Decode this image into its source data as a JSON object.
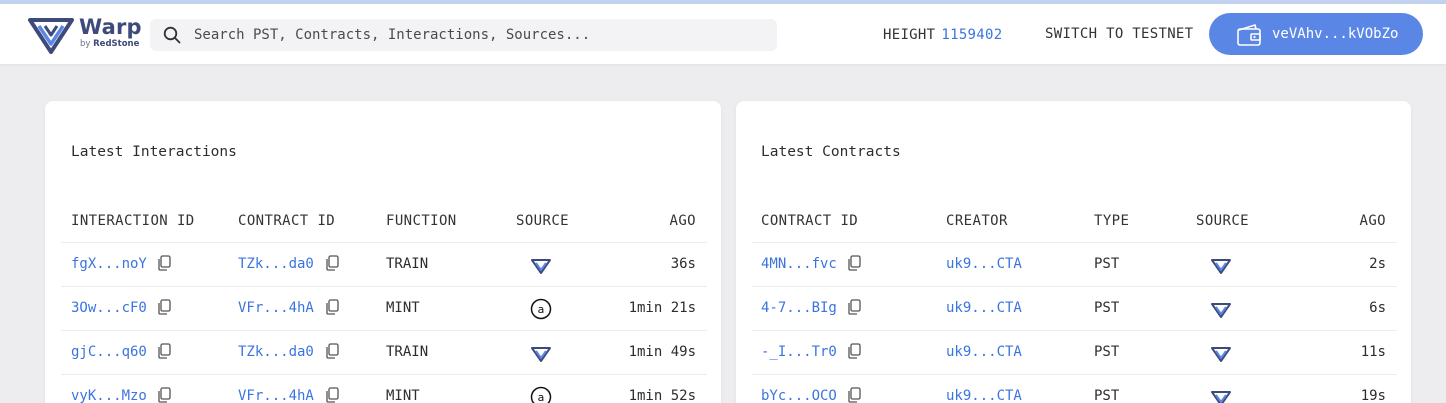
{
  "brand": {
    "name": "Warp",
    "by": "by",
    "by_name": "RedStone"
  },
  "search": {
    "placeholder": "Search PST, Contracts, Interactions, Sources..."
  },
  "network": {
    "height_label": "HEIGHT",
    "height_value": "1159402",
    "switch_label": "SWITCH TO TESTNET"
  },
  "wallet": {
    "address": "veVAhv...kVObZo"
  },
  "colors": {
    "accent": "#3a74e0",
    "wallet_button": "#5a87e6"
  },
  "interactions": {
    "title": "Latest Interactions",
    "headers": [
      "INTERACTION ID",
      "CONTRACT ID",
      "FUNCTION",
      "SOURCE",
      "AGO"
    ],
    "rows": [
      {
        "id": "fgX...noY",
        "contract": "TZk...da0",
        "function": "TRAIN",
        "source": "warp-icon",
        "ago": "36s"
      },
      {
        "id": "3Ow...cF0",
        "contract": "VFr...4hA",
        "function": "MINT",
        "source": "arweave-icon",
        "ago": "1min 21s"
      },
      {
        "id": "gjC...q60",
        "contract": "TZk...da0",
        "function": "TRAIN",
        "source": "warp-icon",
        "ago": "1min 49s"
      },
      {
        "id": "vyK...Mzo",
        "contract": "VFr...4hA",
        "function": "MINT",
        "source": "arweave-icon",
        "ago": "1min 52s"
      }
    ]
  },
  "contracts": {
    "title": "Latest Contracts",
    "headers": [
      "CONTRACT ID",
      "CREATOR",
      "TYPE",
      "SOURCE",
      "AGO"
    ],
    "rows": [
      {
        "id": "4MN...fvc",
        "creator": "uk9...CTA",
        "type": "PST",
        "source": "warp-icon",
        "ago": "2s"
      },
      {
        "id": "4-7...BIg",
        "creator": "uk9...CTA",
        "type": "PST",
        "source": "warp-icon",
        "ago": "6s"
      },
      {
        "id": "-_I...Tr0",
        "creator": "uk9...CTA",
        "type": "PST",
        "source": "warp-icon",
        "ago": "11s"
      },
      {
        "id": "bYc...OCO",
        "creator": "uk9...CTA",
        "type": "PST",
        "source": "warp-icon",
        "ago": "19s"
      }
    ]
  }
}
